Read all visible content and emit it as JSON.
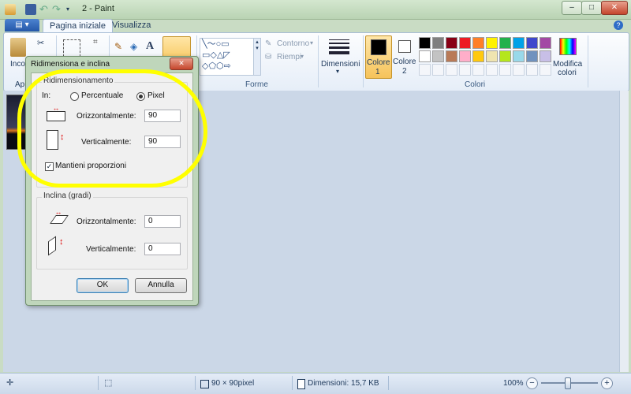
{
  "window": {
    "title": "2 - Paint",
    "min": "–",
    "max": "□",
    "close": "✕"
  },
  "tabs": {
    "file_icon": "▤ ▾",
    "home": "Pagina iniziale",
    "view": "Visualizza",
    "help": "?"
  },
  "ribbon": {
    "paste_label": "Inco",
    "clipboard_label": "Ap",
    "text_tool": "A",
    "outline_label": "Contorno",
    "fill_label": "Riempi",
    "shapes_group": "Forme",
    "size_label": "Dimensioni",
    "color1_label": "Colore",
    "color1_num": "1",
    "color2_label": "Colore",
    "color2_num": "2",
    "edit_colors_label": "Modifica",
    "edit_colors_label2": "colori",
    "colors_group": "Colori",
    "color1": "#000000",
    "color2": "#ffffff",
    "palette_row1": [
      "#000000",
      "#7f7f7f",
      "#880015",
      "#ed1c24",
      "#ff7f27",
      "#fff200",
      "#22b14c",
      "#00a2e8",
      "#3f48cc",
      "#a349a4"
    ],
    "palette_row2": [
      "#ffffff",
      "#c3c3c3",
      "#b97a57",
      "#ffaec9",
      "#ffc90e",
      "#efe4b0",
      "#b5e61d",
      "#99d9ea",
      "#7092be",
      "#c8bfe7"
    ]
  },
  "dialog": {
    "title": "Ridimensiona e inclina",
    "close": "✕",
    "resize_legend": "Ridimensionamento",
    "in_label": "In:",
    "percent_label": "Percentuale",
    "pixel_label": "Pixel",
    "selected_unit": "Pixel",
    "horiz_label": "Orizzontalmente:",
    "horiz_value": "90",
    "vert_label": "Verticalmente:",
    "vert_value": "90",
    "keep_ratio_label": "Mantieni proporzioni",
    "keep_ratio_checked": true,
    "skew_legend": "Inclina (gradi)",
    "skew_horiz_label": "Orizzontalmente:",
    "skew_horiz_value": "0",
    "skew_vert_label": "Verticalmente:",
    "skew_vert_value": "0",
    "ok": "OK",
    "cancel": "Annulla"
  },
  "status": {
    "move_icon": "✛",
    "select_icon": "⬚",
    "image_size": "90 × 90pixel",
    "file_size": "Dimensioni: 15,7 KB",
    "zoom": "100%",
    "zoom_out": "−",
    "zoom_in": "+"
  },
  "highlight_color": "#ffff00"
}
